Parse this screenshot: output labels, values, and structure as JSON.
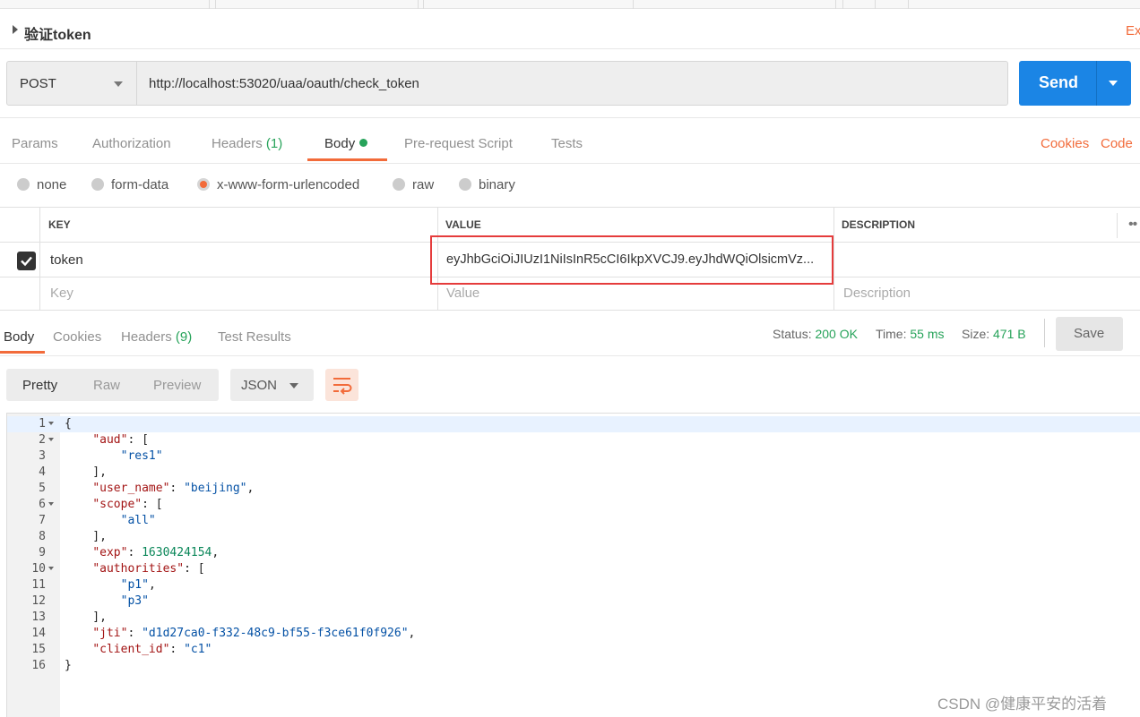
{
  "request": {
    "title": "验证token",
    "title_suffix": "Ex",
    "method": "POST",
    "url": "http://localhost:53020/uaa/oauth/check_token",
    "send_label": "Send"
  },
  "req_tabs": {
    "params": "Params",
    "authorization": "Authorization",
    "headers": "Headers",
    "headers_count": "(1)",
    "body": "Body",
    "prerequest": "Pre-request Script",
    "tests": "Tests",
    "cookies": "Cookies",
    "code": "Code"
  },
  "body_modes": {
    "none": "none",
    "form_data": "form-data",
    "urlencoded": "x-www-form-urlencoded",
    "raw": "raw",
    "binary": "binary",
    "selected": "x-www-form-urlencoded"
  },
  "kv_table": {
    "headers": {
      "key": "KEY",
      "value": "VALUE",
      "description": "DESCRIPTION"
    },
    "rows": [
      {
        "checked": true,
        "key": "token",
        "value": "eyJhbGciOiJIUzI1NiIsInR5cCI6IkpXVCJ9.eyJhdWQiOlsicmVz...",
        "description": ""
      }
    ],
    "placeholder": {
      "key": "Key",
      "value": "Value",
      "description": "Description"
    }
  },
  "resp_tabs": {
    "body": "Body",
    "cookies": "Cookies",
    "headers": "Headers",
    "headers_count": "(9)",
    "test_results": "Test Results"
  },
  "response_status": {
    "status_label": "Status:",
    "status_value": "200 OK",
    "time_label": "Time:",
    "time_value": "55 ms",
    "size_label": "Size:",
    "size_value": "471 B",
    "save_label": "Save"
  },
  "view": {
    "pretty": "Pretty",
    "raw": "Raw",
    "preview": "Preview",
    "format": "JSON"
  },
  "code_lines": [
    {
      "n": "1",
      "fold": true,
      "html": "{"
    },
    {
      "n": "2",
      "fold": true,
      "html": "    <span class=\"k\">\"aud\"</span>: ["
    },
    {
      "n": "3",
      "fold": false,
      "html": "        <span class=\"s\">\"res1\"</span>"
    },
    {
      "n": "4",
      "fold": false,
      "html": "    ],"
    },
    {
      "n": "5",
      "fold": false,
      "html": "    <span class=\"k\">\"user_name\"</span>: <span class=\"s\">\"beijing\"</span>,"
    },
    {
      "n": "6",
      "fold": true,
      "html": "    <span class=\"k\">\"scope\"</span>: ["
    },
    {
      "n": "7",
      "fold": false,
      "html": "        <span class=\"s\">\"all\"</span>"
    },
    {
      "n": "8",
      "fold": false,
      "html": "    ],"
    },
    {
      "n": "9",
      "fold": false,
      "html": "    <span class=\"k\">\"exp\"</span>: <span class=\"n\">1630424154</span>,"
    },
    {
      "n": "10",
      "fold": true,
      "html": "    <span class=\"k\">\"authorities\"</span>: ["
    },
    {
      "n": "11",
      "fold": false,
      "html": "        <span class=\"s\">\"p1\"</span>,"
    },
    {
      "n": "12",
      "fold": false,
      "html": "        <span class=\"s\">\"p3\"</span>"
    },
    {
      "n": "13",
      "fold": false,
      "html": "    ],"
    },
    {
      "n": "14",
      "fold": false,
      "html": "    <span class=\"k\">\"jti\"</span>: <span class=\"s\">\"d1d27ca0-f332-48c9-bf55-f3ce61f0f926\"</span>,"
    },
    {
      "n": "15",
      "fold": false,
      "html": "    <span class=\"k\">\"client_id\"</span>: <span class=\"s\">\"c1\"</span>"
    },
    {
      "n": "16",
      "fold": false,
      "html": "}"
    }
  ],
  "watermark": "CSDN @健康平安的活着",
  "colors": {
    "accent": "#f26b3a",
    "send": "#1b85e5",
    "status_green": "#27a35a",
    "highlight_box": "#e53c3c"
  }
}
